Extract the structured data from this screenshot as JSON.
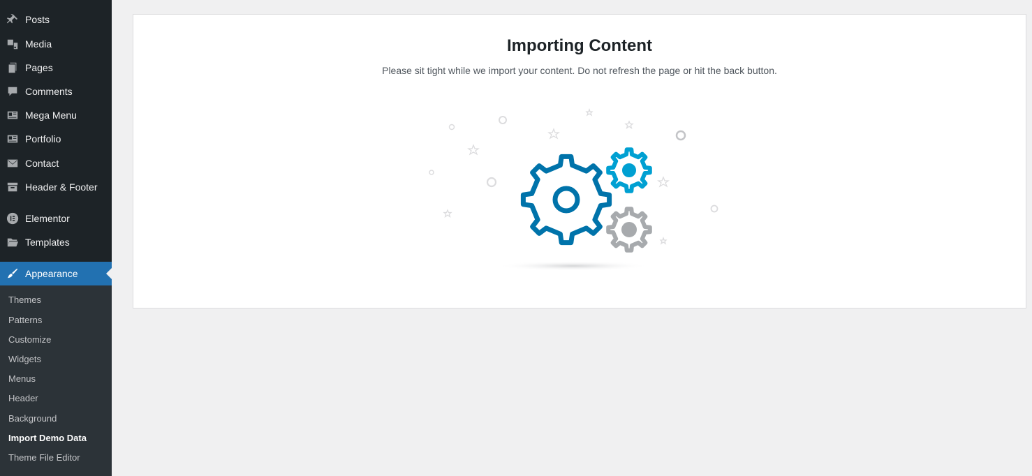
{
  "sidebar": {
    "items": [
      {
        "label": "Posts",
        "icon": "pin-icon"
      },
      {
        "label": "Media",
        "icon": "media-icon"
      },
      {
        "label": "Pages",
        "icon": "pages-icon"
      },
      {
        "label": "Comments",
        "icon": "comments-icon"
      },
      {
        "label": "Mega Menu",
        "icon": "mega-menu-icon"
      },
      {
        "label": "Portfolio",
        "icon": "portfolio-icon"
      },
      {
        "label": "Contact",
        "icon": "envelope-icon"
      },
      {
        "label": "Header & Footer",
        "icon": "header-footer-icon"
      },
      {
        "label": "Elementor",
        "icon": "elementor-icon"
      },
      {
        "label": "Templates",
        "icon": "folder-icon"
      },
      {
        "label": "Appearance",
        "icon": "paintbrush-icon",
        "active": true
      }
    ],
    "submenu": [
      {
        "label": "Themes"
      },
      {
        "label": "Patterns"
      },
      {
        "label": "Customize"
      },
      {
        "label": "Widgets"
      },
      {
        "label": "Menus"
      },
      {
        "label": "Header"
      },
      {
        "label": "Background"
      },
      {
        "label": "Import Demo Data",
        "current": true
      },
      {
        "label": "Theme File Editor"
      }
    ]
  },
  "main": {
    "title": "Importing Content",
    "subtitle": "Please sit tight while we import your content. Do not refresh the page or hit the back button."
  },
  "illustration": {
    "icon": "gears-icon",
    "colors": {
      "large_gear": "#0073aa",
      "small_gear_top": "#00a0d2",
      "small_gear_bottom": "#a7aaad"
    }
  }
}
